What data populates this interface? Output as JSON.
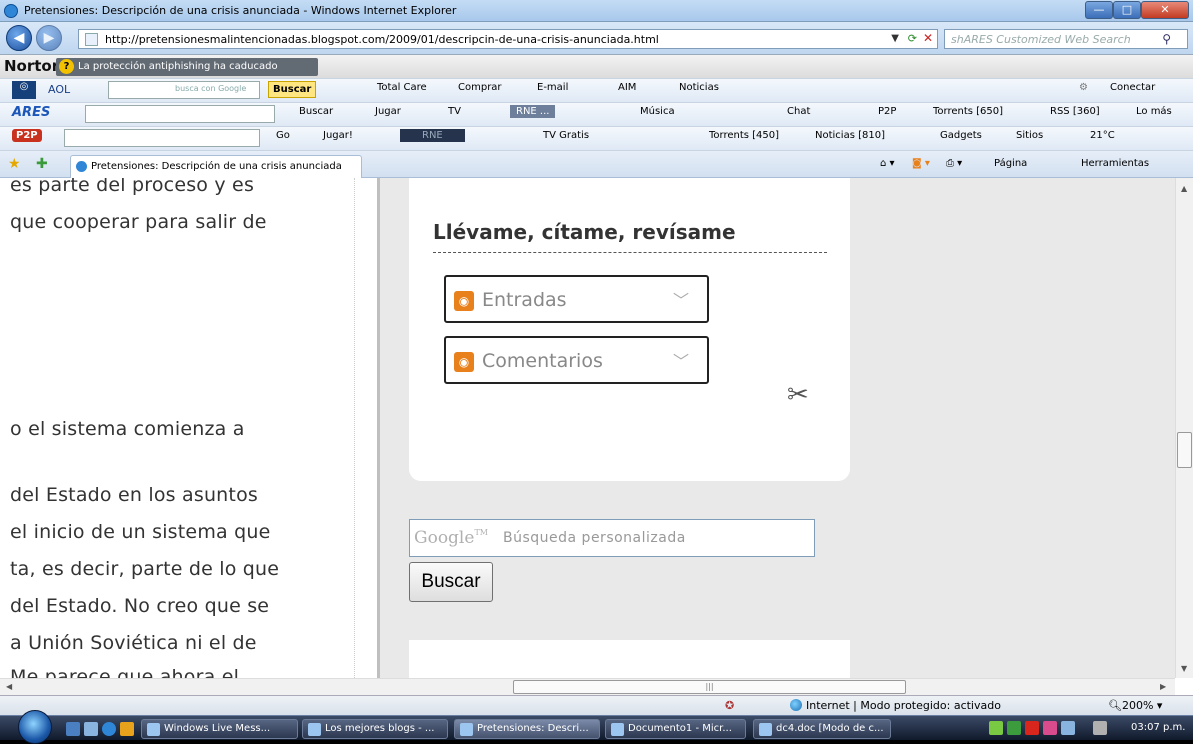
{
  "window": {
    "title": "Pretensiones: Descripción de una crisis anunciada - Windows Internet Explorer"
  },
  "address_bar": {
    "url": "http://pretensionesmalintencionadas.blogspot.com/2009/01/descripcin-de-una-crisis-anunciada.html"
  },
  "search_box": {
    "placeholder": "shARES Customized Web Search"
  },
  "norton": {
    "brand": "Norton",
    "warning": "La protección antiphishing ha caducado"
  },
  "aol_bar": {
    "aol": "AOL",
    "search_placeholder": "busca con Google",
    "buscar": "Buscar",
    "items": [
      "Total Care",
      "Comprar",
      "E-mail",
      "AIM",
      "Noticias"
    ],
    "conectar": "Conectar"
  },
  "ares_bar": {
    "brand": "ARES",
    "buscar": "Buscar",
    "jugar": "Jugar",
    "tv": "TV",
    "rne": "RNE ...",
    "musica": "Música",
    "chat": "Chat",
    "p2p": "P2P",
    "torrents": "Torrents [650]",
    "rss": "RSS [360]",
    "lo_mas": "Lo más"
  },
  "p2p_bar": {
    "go": "Go",
    "jugar": "Jugar!",
    "rne": "RNE",
    "tv_gratis": "TV Gratis",
    "torrents": "Torrents [450]",
    "noticias": "Noticias [810]",
    "gadgets": "Gadgets",
    "sitios": "Sitios",
    "temp": "21°C"
  },
  "tabs": {
    "active_label": "Pretensiones: Descripción de una crisis anunciada",
    "pagina": "Página",
    "herramientas": "Herramientas"
  },
  "article": {
    "lines": [
      "es parte del proceso y es",
      "que cooperar para salir de",
      "o el sistema comienza a",
      "del Estado en los asuntos",
      "el inicio de un sistema que",
      "ta, es decir, parte de lo que",
      "del Estado. No creo que se",
      "a Unión Soviética ni el de",
      "Me parece que ahora el"
    ]
  },
  "sidebar": {
    "widget_title": "Llévame, cítame, revísame",
    "entradas": "Entradas",
    "comentarios": "Comentarios",
    "google_logo": "Google",
    "google_tm": "TM",
    "search_placeholder": "Búsqueda personalizada",
    "search_button": "Buscar"
  },
  "status_bar": {
    "zone": "Internet | Modo protegido: activado",
    "zoom": "200%"
  },
  "taskbar": {
    "items": [
      "Windows Live Mess...",
      "Los mejores blogs - ...",
      "Pretensiones: Descri...",
      "Documento1 - Micr...",
      "dc4.doc [Modo de c..."
    ],
    "clock": "03:07 p.m."
  }
}
